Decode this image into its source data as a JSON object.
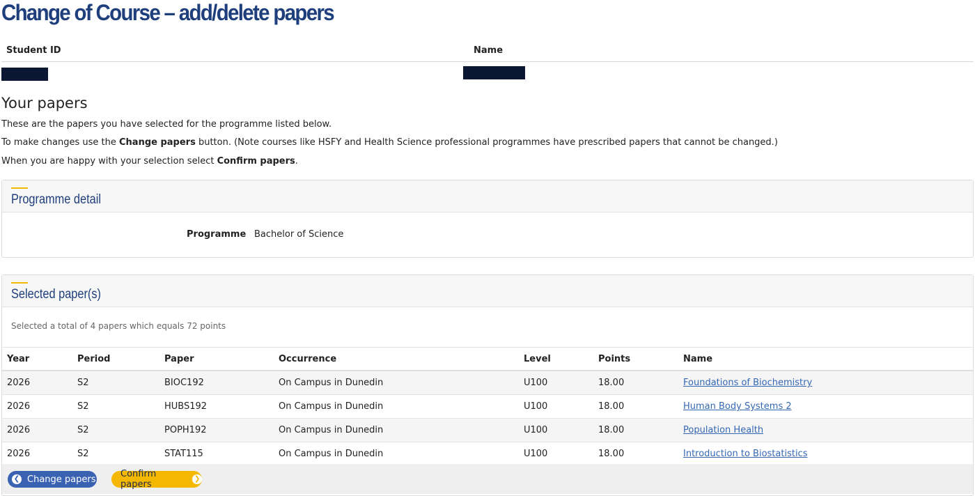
{
  "page_title": "Change of Course – add/delete papers",
  "student_info": {
    "student_id_label": "Student ID",
    "name_label": "Name"
  },
  "your_papers": {
    "heading": "Your papers",
    "line1": "These are the papers you have selected for the programme listed below.",
    "line2_prefix": "To make changes use the ",
    "line2_bold": "Change papers",
    "line2_suffix": " button. (Note courses like HSFY and Health Science professional programmes have prescribed papers that cannot be changed.)",
    "line3_prefix": "When you are happy with your selection select ",
    "line3_bold": "Confirm papers",
    "line3_suffix": "."
  },
  "programme_detail": {
    "title": "Programme detail",
    "programme_label": "Programme",
    "programme_value": "Bachelor of Science"
  },
  "selected_papers": {
    "title": "Selected paper(s)",
    "summary": "Selected a total of 4 papers which equals 72 points",
    "columns": [
      "Year",
      "Period",
      "Paper",
      "Occurrence",
      "Level",
      "Points",
      "Name"
    ],
    "rows": [
      [
        "2026",
        "S2",
        "BIOC192",
        "On Campus in Dunedin",
        "U100",
        "18.00",
        "Foundations of Biochemistry"
      ],
      [
        "2026",
        "S2",
        "HUBS192",
        "On Campus in Dunedin",
        "U100",
        "18.00",
        "Human Body Systems 2"
      ],
      [
        "2026",
        "S2",
        "POPH192",
        "On Campus in Dunedin",
        "U100",
        "18.00",
        "Population Health"
      ],
      [
        "2026",
        "S2",
        "STAT115",
        "On Campus in Dunedin",
        "U100",
        "18.00",
        "Introduction to Biostatistics"
      ]
    ]
  },
  "buttons": {
    "change_label": "Change papers",
    "change_icon": "chevron-left-circle-icon",
    "confirm_label": "Confirm papers",
    "confirm_icon": "chevron-right-circle-icon"
  },
  "colors": {
    "title_blue": "#1e3f7c",
    "accent_yellow": "#f2b705",
    "change_button": "#3a62b3",
    "confirm_button": "#f5b800",
    "link": "#3568b4"
  }
}
